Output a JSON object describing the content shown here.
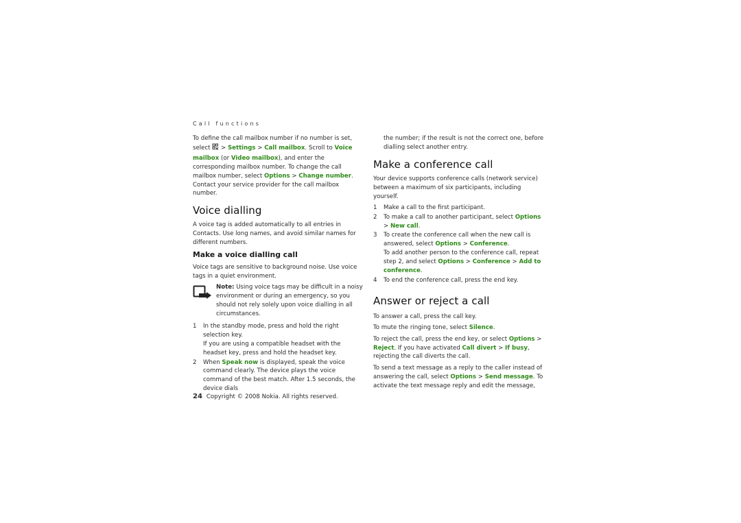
{
  "header": {
    "running_title": "Call functions"
  },
  "left": {
    "intro": {
      "t1": "To define the call mailbox number if no number is set, select ",
      "t2": " > ",
      "settings": "Settings",
      "t3": " > ",
      "call_mailbox": "Call mailbox",
      "t4": ". Scroll to ",
      "voice_mailbox": "Voice mailbox",
      "t5": " (or ",
      "video_mailbox": "Video mailbox",
      "t6": "), and enter the corresponding mailbox number. To change the call mailbox number, select ",
      "options": "Options",
      "t7": " > ",
      "change_number": "Change number",
      "t8": ". Contact your service provider for the call mailbox number."
    },
    "voice_dialling": {
      "heading": "Voice dialling",
      "body": "A voice tag is added automatically to all entries in Contacts. Use long names, and avoid similar names for different numbers.",
      "subheading": "Make a voice dialling call",
      "sub_body": "Voice tags are sensitive to background noise. Use voice tags in a quiet environment.",
      "note_label": "Note:",
      "note_text": " Using voice tags may be difficult in a noisy environment or during an emergency, so you should not rely solely upon voice dialling in all circumstances.",
      "steps": [
        {
          "num": "1",
          "text": "In the standby mode, press and hold the right selection key.",
          "extra": "If you are using a compatible headset with the headset key, press and hold the headset key."
        },
        {
          "num": "2",
          "t1": "When ",
          "speak_now": "Speak now",
          "t2": " is displayed, speak the voice command clearly. The device plays the voice command of the best match. After 1.5 seconds, the device dials"
        }
      ]
    }
  },
  "right": {
    "continuation": "the number; if the result is not the correct one, before dialling select another entry.",
    "conference": {
      "heading": "Make a conference call",
      "body": "Your device supports conference calls (network service) between a maximum of six participants, including yourself.",
      "steps": [
        {
          "num": "1",
          "text": "Make a call to the first participant."
        },
        {
          "num": "2",
          "t1": "To make a call to another participant, select ",
          "options": "Options",
          "t2": " > ",
          "new_call": "New call",
          "t3": "."
        },
        {
          "num": "3",
          "t1": "To create the conference call when the new call is answered, select ",
          "options": "Options",
          "t2": " > ",
          "conference": "Conference",
          "t3": ".",
          "e1": "To add another person to the conference call, repeat step 2, and select ",
          "e_options": "Options",
          "e2": " > ",
          "e_conference": "Conference",
          "e3": " > ",
          "add_to_conference": "Add to conference",
          "e4": "."
        },
        {
          "num": "4",
          "text": "To end the conference call, press the end key."
        }
      ]
    },
    "answer": {
      "heading": "Answer or reject a call",
      "p1": "To answer a call, press the call key.",
      "p2_t1": "To mute the ringing tone, select ",
      "silence": "Silence",
      "p2_t2": ".",
      "p3_t1": "To reject the call, press the end key, or select ",
      "options": "Options",
      "p3_t2": " > ",
      "reject": "Reject",
      "p3_t3": ". If you have activated ",
      "call_divert": "Call divert",
      "p3_t4": " > ",
      "if_busy": "If busy",
      "p3_t5": ", rejecting the call diverts the call.",
      "p4_t1": "To send a text message as a reply to the caller instead of answering the call, select ",
      "options2": "Options",
      "p4_t2": " > ",
      "send_message": "Send message",
      "p4_t3": ". To activate the text message reply and edit the message,"
    }
  },
  "footer": {
    "page_number": "24",
    "copyright": "Copyright © 2008 Nokia. All rights reserved."
  },
  "colors": {
    "menu_green": "#2f8a1a",
    "text": "#2a2a2a"
  }
}
